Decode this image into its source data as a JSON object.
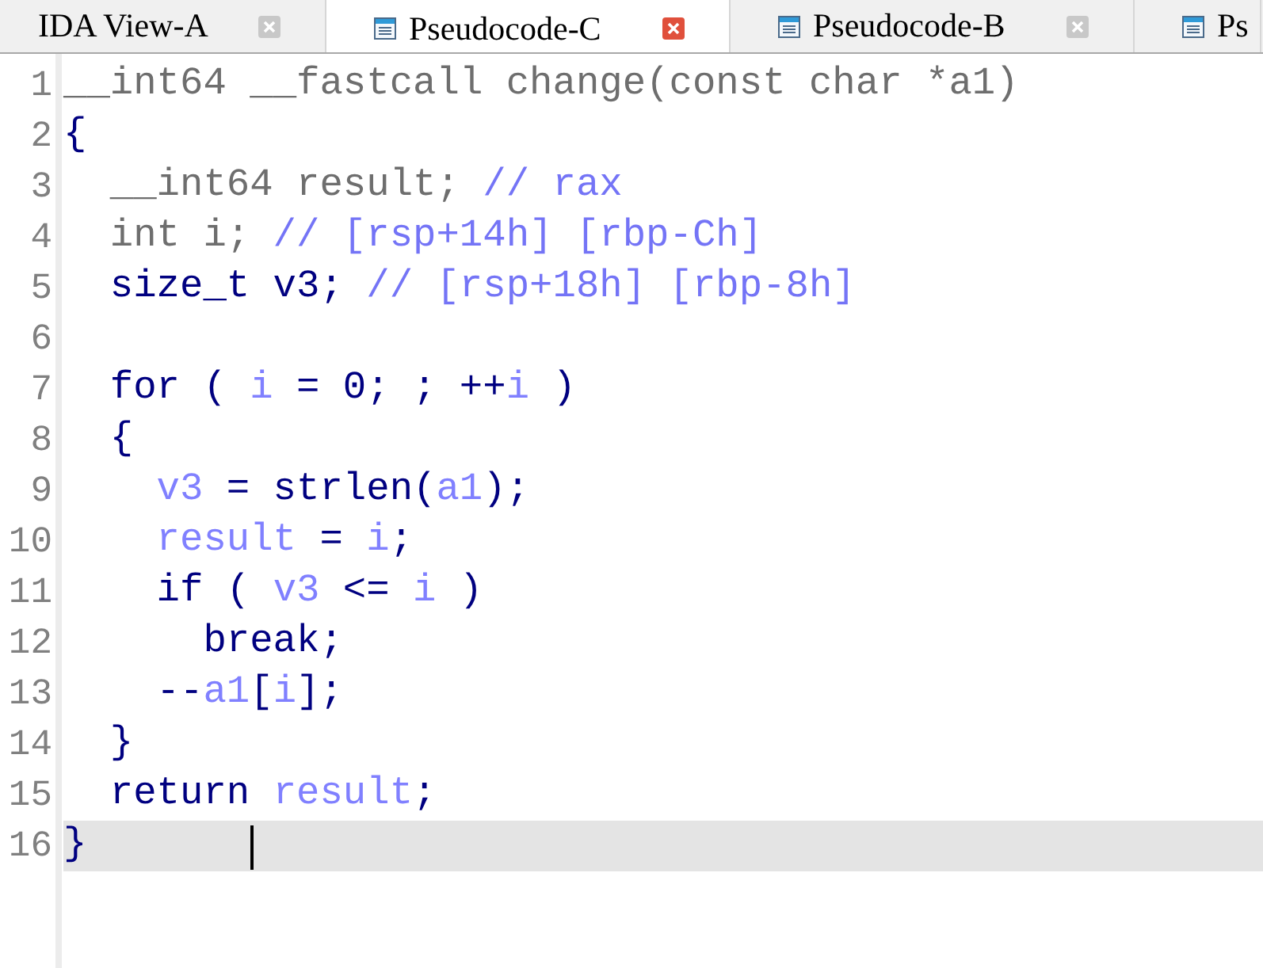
{
  "tabs": [
    {
      "label": "IDA View-A",
      "selected": false
    },
    {
      "label": "Pseudocode-C",
      "selected": true
    },
    {
      "label": "Pseudocode-B",
      "selected": false
    },
    {
      "label": "Ps",
      "selected": false
    }
  ],
  "lines": [
    {
      "number": "1",
      "tokens": [
        {
          "text": "__int64 __fastcall change(const char *a1)",
          "kind": "muted"
        }
      ]
    },
    {
      "number": "2",
      "tokens": [
        {
          "text": "{",
          "kind": "code"
        }
      ],
      "children": [
        {
          "number": "3",
          "tokens": [
            {
              "text": "__int64 result;",
              "kind": "muted"
            },
            {
              "text": " // rax",
              "kind": "comment"
            }
          ]
        },
        {
          "number": "4",
          "tokens": [
            {
              "text": "int i;",
              "kind": "muted"
            },
            {
              "text": " // [rsp+14h] [rbp-Ch]",
              "kind": "comment"
            }
          ]
        },
        {
          "number": "5",
          "tokens": [
            {
              "text": "size_t v3;",
              "kind": "code"
            },
            {
              "text": " // [rsp+18h] [rbp-8h]",
              "kind": "comment"
            }
          ]
        },
        {
          "number": "6"
        },
        {
          "number": "7",
          "tokens": [
            {
              "text": "for ( ",
              "kind": "code"
            },
            {
              "text": "i",
              "kind": "var"
            },
            {
              "text": " = 0; ; ++",
              "kind": "code"
            },
            {
              "text": "i",
              "kind": "var"
            },
            {
              "text": " )",
              "kind": "code"
            }
          ]
        },
        {
          "number": "8",
          "tokens": [
            {
              "text": "{",
              "kind": "code"
            }
          ],
          "children": [
            {
              "number": "9",
              "tokens": [
                {
                  "text": "v3",
                  "kind": "var"
                },
                {
                  "text": " = strlen(",
                  "kind": "code"
                },
                {
                  "text": "a1",
                  "kind": "var"
                },
                {
                  "text": ");",
                  "kind": "code"
                }
              ]
            },
            {
              "number": "10",
              "tokens": [
                {
                  "text": "result",
                  "kind": "var"
                },
                {
                  "text": " = ",
                  "kind": "code"
                },
                {
                  "text": "i",
                  "kind": "var"
                },
                {
                  "text": ";",
                  "kind": "code"
                }
              ]
            },
            {
              "number": "11",
              "tokens": [
                {
                  "text": "if ( ",
                  "kind": "code"
                },
                {
                  "text": "v3",
                  "kind": "var"
                },
                {
                  "text": " <= ",
                  "kind": "code"
                },
                {
                  "text": "i",
                  "kind": "var"
                },
                {
                  "text": " )",
                  "kind": "code"
                }
              ],
              "children": [
                {
                  "number": "12",
                  "tokens": [
                    {
                      "text": "break;",
                      "kind": "code"
                    }
                  ]
                }
              ]
            },
            {
              "number": "13",
              "tokens": [
                {
                  "text": "--",
                  "kind": "code"
                },
                {
                  "text": "a1",
                  "kind": "var"
                },
                {
                  "text": "[",
                  "kind": "code"
                },
                {
                  "text": "i",
                  "kind": "var"
                },
                {
                  "text": "];",
                  "kind": "code"
                }
              ]
            }
          ]
        },
        {
          "number": "14",
          "tokens": [
            {
              "text": "}",
              "kind": "code"
            }
          ]
        },
        {
          "number": "15",
          "tokens": [
            {
              "text": "return ",
              "kind": "code"
            },
            {
              "text": "result",
              "kind": "var"
            },
            {
              "text": ";",
              "kind": "code"
            }
          ]
        }
      ]
    },
    {
      "number": "16",
      "tokens": [
        {
          "text": "}",
          "kind": "code"
        }
      ],
      "current": true
    }
  ]
}
